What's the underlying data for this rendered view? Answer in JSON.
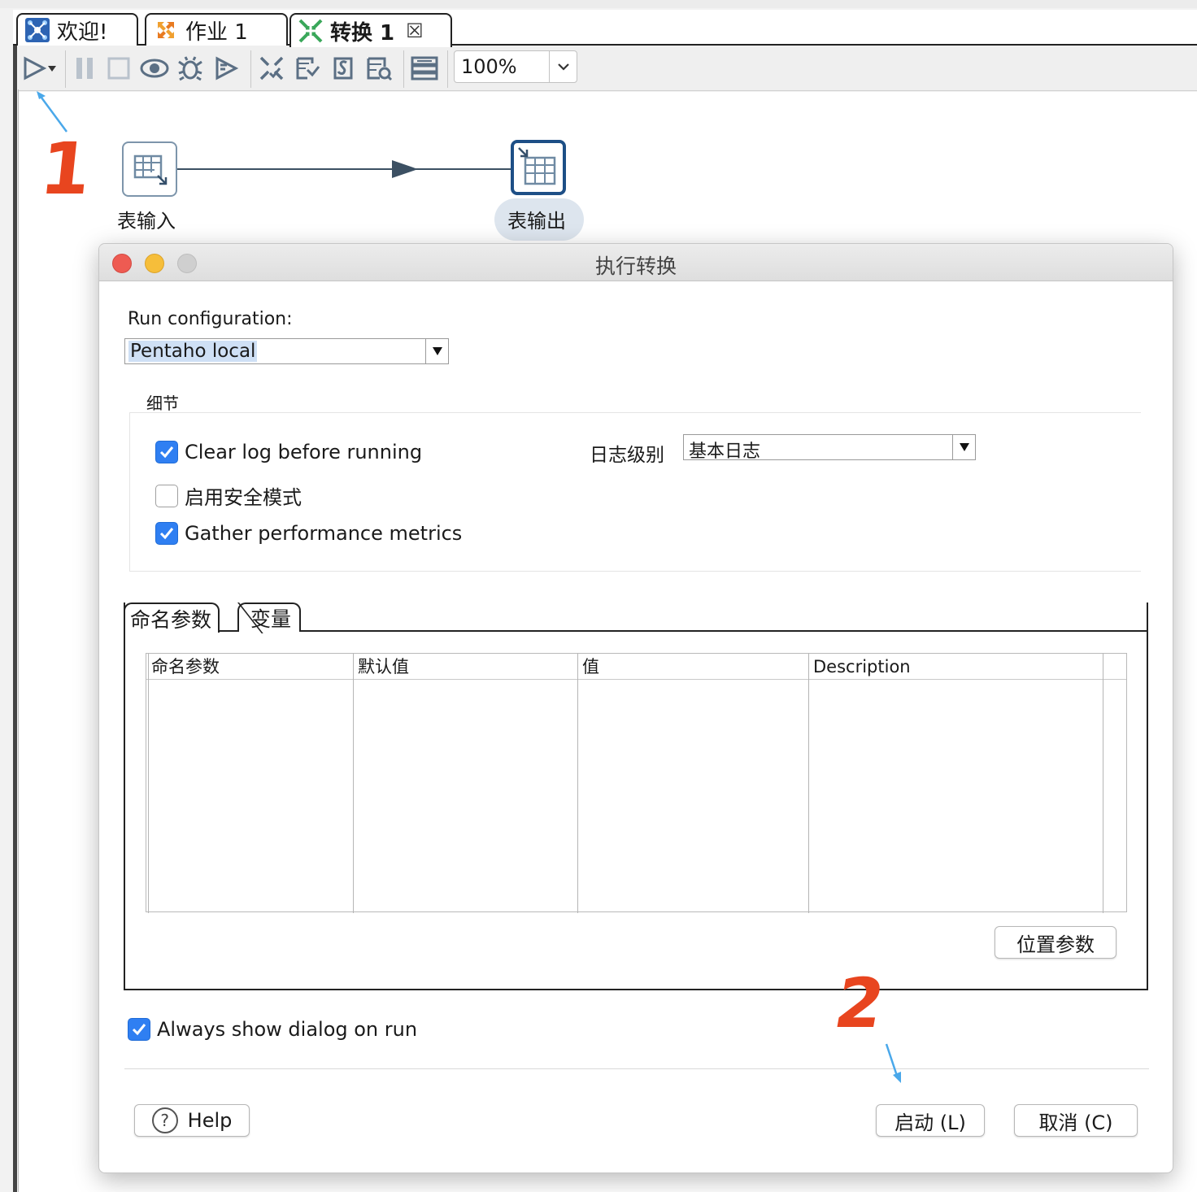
{
  "tabs": [
    {
      "label": "欢迎!"
    },
    {
      "label": "作业 1"
    },
    {
      "label": "转换 1",
      "close": "☒"
    }
  ],
  "toolbar": {
    "zoom": "100%",
    "icons": [
      "run-icon",
      "run-dropdown-icon",
      "pause-icon",
      "stop-icon",
      "preview-icon",
      "debug-icon",
      "replay-icon",
      "verify-icon",
      "impact-icon",
      "sql-icon",
      "explore-db-icon",
      "show-results-icon"
    ]
  },
  "canvas": {
    "steps": [
      {
        "label": "表输入"
      },
      {
        "label": "表输出"
      }
    ]
  },
  "annotations": {
    "marker1": "1",
    "marker2": "2"
  },
  "dialog": {
    "title": "执行转换",
    "run_config_label": "Run configuration:",
    "run_config_value": "Pentaho local",
    "details_label": "细节",
    "options": [
      {
        "label": "Clear log before running",
        "checked": true
      },
      {
        "label": "启用安全模式",
        "checked": false
      },
      {
        "label": "Gather performance metrics",
        "checked": true
      }
    ],
    "log_level_label": "日志级别",
    "log_level_value": "基本日志",
    "param_tabs": [
      "命名参数",
      "变量"
    ],
    "param_columns": [
      "命名参数",
      "默认值",
      "值",
      "Description"
    ],
    "position_params_button": "位置参数",
    "always_show": {
      "label": "Always show dialog on run",
      "checked": true
    },
    "help_button": "Help",
    "help_icon": "?",
    "start_button": "启动 (L)",
    "cancel_button": "取消 (C)"
  },
  "colors": {
    "accent_blue": "#2f7ff2",
    "annotation_red": "#e8451f",
    "annotation_arrow": "#4aa8ea",
    "toolbar_icon": "#5b6f84"
  }
}
